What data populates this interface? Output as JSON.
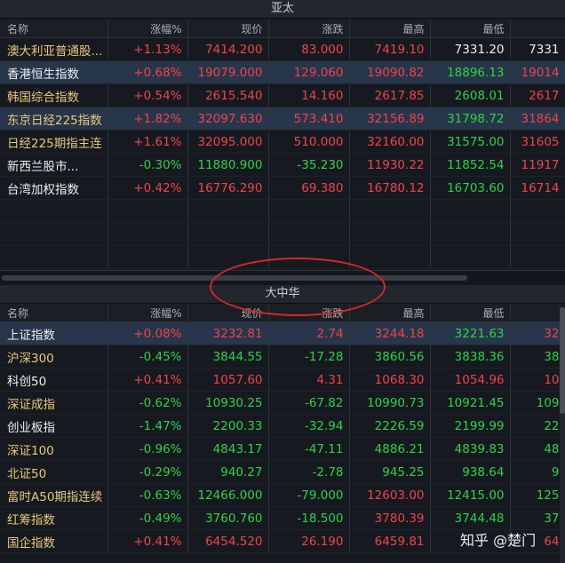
{
  "sections": {
    "asia": {
      "title": "亚太",
      "headers": [
        "名称",
        "涨幅%",
        "现价",
        "涨跌",
        "最高",
        "最低",
        ""
      ],
      "rows": [
        {
          "name": "澳大利亚普通股...",
          "pct": "+1.13%",
          "price": "7414.200",
          "chg": "83.000",
          "high": "7419.10",
          "low": "7331.20",
          "extra": "7331"
        },
        {
          "name": "香港恒生指数",
          "pct": "+0.68%",
          "price": "19079.000",
          "chg": "129.060",
          "high": "19090.82",
          "low": "18896.13",
          "extra": "19014"
        },
        {
          "name": "韩国综合指数",
          "pct": "+0.54%",
          "price": "2615.540",
          "chg": "14.160",
          "high": "2617.85",
          "low": "2608.01",
          "extra": "2617"
        },
        {
          "name": "东京日经225指数",
          "pct": "+1.82%",
          "price": "32097.630",
          "chg": "573.410",
          "high": "32156.89",
          "low": "31798.72",
          "extra": "31864"
        },
        {
          "name": "日经225期指主连",
          "pct": "+1.61%",
          "price": "32095.000",
          "chg": "510.000",
          "high": "32160.00",
          "low": "31575.00",
          "extra": "31605"
        },
        {
          "name": "新西兰股市...",
          "pct": "-0.30%",
          "price": "11880.900",
          "chg": "-35.230",
          "high": "11930.22",
          "low": "11852.54",
          "extra": "11917"
        },
        {
          "name": "台湾加权指数",
          "pct": "+0.42%",
          "price": "16776.290",
          "chg": "69.380",
          "high": "16780.12",
          "low": "16703.60",
          "extra": "16714"
        }
      ]
    },
    "china": {
      "title": "大中华",
      "headers": [
        "名称",
        "涨幅%",
        "现价",
        "涨跌",
        "最高",
        "最低",
        ""
      ],
      "rows": [
        {
          "name": "上证指数",
          "pct": "+0.08%",
          "price": "3232.81",
          "chg": "2.74",
          "high": "3244.18",
          "low": "3221.63",
          "extra": "32"
        },
        {
          "name": "沪深300",
          "pct": "-0.45%",
          "price": "3844.55",
          "chg": "-17.28",
          "high": "3860.56",
          "low": "3838.36",
          "extra": "38"
        },
        {
          "name": "科创50",
          "pct": "+0.41%",
          "price": "1057.60",
          "chg": "4.31",
          "high": "1068.30",
          "low": "1054.96",
          "extra": "10"
        },
        {
          "name": "深证成指",
          "pct": "-0.62%",
          "price": "10930.25",
          "chg": "-67.82",
          "high": "10990.73",
          "low": "10921.45",
          "extra": "109"
        },
        {
          "name": "创业板指",
          "pct": "-1.47%",
          "price": "2200.33",
          "chg": "-32.94",
          "high": "2226.59",
          "low": "2199.99",
          "extra": "22"
        },
        {
          "name": "深证100",
          "pct": "-0.96%",
          "price": "4843.17",
          "chg": "-47.11",
          "high": "4886.21",
          "low": "4839.83",
          "extra": "48"
        },
        {
          "name": "北证50",
          "pct": "-0.29%",
          "price": "940.27",
          "chg": "-2.78",
          "high": "945.25",
          "low": "938.64",
          "extra": "9"
        },
        {
          "name": "富时A50期指连续",
          "pct": "-0.63%",
          "price": "12466.000",
          "chg": "-79.000",
          "high": "12603.00",
          "low": "12415.00",
          "extra": "125"
        },
        {
          "name": "红筹指数",
          "pct": "-0.49%",
          "price": "3760.760",
          "chg": "-18.500",
          "high": "3780.39",
          "low": "3744.48",
          "extra": "37"
        },
        {
          "name": "国企指数",
          "pct": "+0.41%",
          "price": "6454.520",
          "chg": "26.190",
          "high": "6459.81",
          "low": "",
          "extra": "64"
        }
      ]
    }
  },
  "watermark": "知乎 @楚门"
}
